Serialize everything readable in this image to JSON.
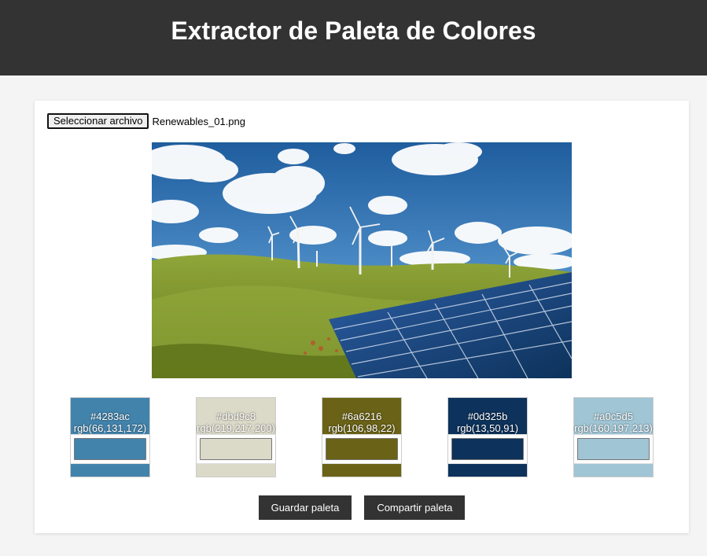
{
  "header": {
    "title": "Extractor de Paleta de Colores"
  },
  "file_input": {
    "button_label": "Seleccionar archivo",
    "file_name": "Renewables_01.png"
  },
  "preview": {
    "alt": "wind-turbines-and-solar-panels-photo"
  },
  "palette": [
    {
      "hex": "#4283ac",
      "rgb": "rgb(66,131,172)"
    },
    {
      "hex": "#dbd9c8",
      "rgb": "rgb(219,217,200)"
    },
    {
      "hex": "#6a6216",
      "rgb": "rgb(106,98,22)"
    },
    {
      "hex": "#0d325b",
      "rgb": "rgb(13,50,91)"
    },
    {
      "hex": "#a0c5d5",
      "rgb": "rgb(160,197,213)"
    }
  ],
  "actions": {
    "save_label": "Guardar paleta",
    "share_label": "Compartir paleta"
  }
}
